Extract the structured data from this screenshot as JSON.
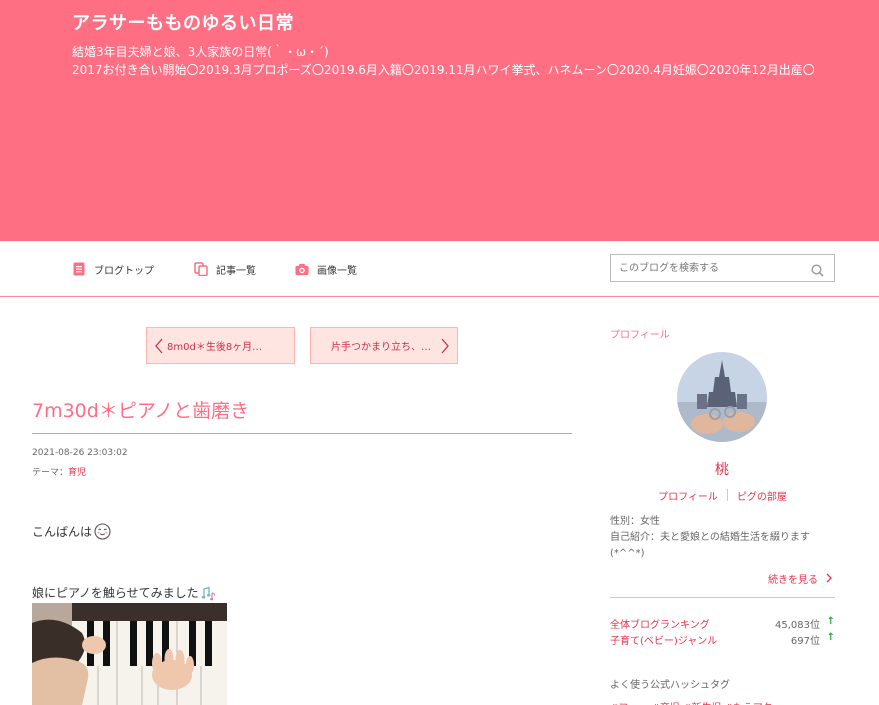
{
  "header": {
    "title": "アラサーもものゆるい日常",
    "desc_line1": "結婚3年目夫婦と娘、3人家族の日常(｀・ω・´)",
    "desc_line2": "2017お付き合い開始〇2019.3月プロポーズ〇2019.6月入籍〇2019.11月ハワイ挙式、ハネムーン〇2020.4月妊娠〇2020年12月出産〇",
    "bg_color": "#ff6f83"
  },
  "nav": {
    "items": [
      {
        "label": "ブログトップ",
        "icon": "document-icon"
      },
      {
        "label": "記事一覧",
        "icon": "copy-icon"
      },
      {
        "label": "画像一覧",
        "icon": "camera-icon"
      }
    ],
    "search_placeholder": "このブログを検索する"
  },
  "pager": {
    "prev_label": "8m0d＊生後8ヶ月…",
    "next_label": "片手つかまり立ち、…"
  },
  "entry": {
    "title": "7m30d＊ピアノと歯磨き",
    "date": "2021-08-26 23:03:02",
    "theme_label": "テーマ：",
    "theme_value": "育児",
    "para1": "こんばんは",
    "para2": "娘にピアノを触らせてみました"
  },
  "sidebar": {
    "profile_heading": "プロフィール",
    "nickname": "桃",
    "profile_link": "プロフィール",
    "room_link": "ピグの部屋",
    "gender": "性別：女性",
    "intro_line1": "自己紹介：夫と愛娘との結婚生活を綴ります",
    "intro_line2": "(*^^*)",
    "more_link": "続きを見る",
    "rankings": [
      {
        "label": "全体ブログランキング",
        "value": "45,083位",
        "trend": "↑"
      },
      {
        "label": "子育て(ベビー)ジャンル",
        "value": "697位",
        "trend": "↑"
      }
    ],
    "hashtag_heading": "よく使う公式ハッシュタグ",
    "hashtags_partial": "#ファッ #育児 #新生児 #もうアク"
  },
  "colors": {
    "accent": "#ff6f83",
    "link": "#e8334a",
    "pager_bg": "#ffe5e1",
    "trend_up": "#2aa745"
  }
}
